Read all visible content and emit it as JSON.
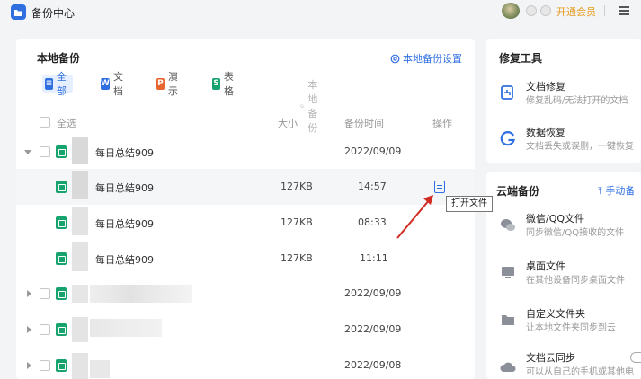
{
  "titlebar": {
    "title": "备份中心",
    "vip_label": "开通会员",
    "menu_icon": "menu-icon"
  },
  "local_backup": {
    "title": "本地备份",
    "settings_label": "本地备份设置",
    "filters": [
      {
        "label": "全部",
        "icon": "list-icon",
        "color": "#2f6fe0",
        "active": true
      },
      {
        "label": "文档",
        "icon": "W",
        "color": "#2f6fe0",
        "active": false
      },
      {
        "label": "演示",
        "icon": "P",
        "color": "#e8662e",
        "active": false
      },
      {
        "label": "表格",
        "icon": "S",
        "color": "#16a36e",
        "active": false
      }
    ],
    "search_placeholder": "本地备份",
    "columns": {
      "select_all": "全选",
      "size": "大小",
      "backup_time": "备份时间",
      "actions": "操作"
    },
    "rows": [
      {
        "name": "每日总结909",
        "size": "",
        "time": "2022/09/09",
        "type": "group",
        "expanded": true
      },
      {
        "name": "每日总结909",
        "size": "127KB",
        "time": "14:57",
        "type": "file",
        "highlighted": true
      },
      {
        "name": "每日总结909",
        "size": "127KB",
        "time": "08:33",
        "type": "file"
      },
      {
        "name": "每日总结909",
        "size": "127KB",
        "time": "11:11",
        "type": "file"
      },
      {
        "name": "",
        "size": "",
        "time": "2022/09/09",
        "type": "group",
        "expanded": false
      },
      {
        "name": "",
        "size": "",
        "time": "2022/09/09",
        "type": "group",
        "expanded": false
      },
      {
        "name": "",
        "size": "",
        "time": "2022/09/08",
        "type": "group",
        "expanded": false
      }
    ],
    "tooltip": "打开文件"
  },
  "repair_tools": {
    "title": "修复工具",
    "items": [
      {
        "title": "文档修复",
        "desc": "修复乱码/无法打开的文档",
        "icon": "doc-repair-icon"
      },
      {
        "title": "数据恢复",
        "desc": "文档丢失或误删，一键恢复",
        "icon": "data-recovery-icon"
      }
    ]
  },
  "cloud_backup": {
    "title": "云端备份",
    "manual_label": "手动备",
    "items": [
      {
        "title": "微信/QQ文件",
        "desc": "同步微信/QQ接收的文件",
        "icon": "wechat-qq-icon"
      },
      {
        "title": "桌面文件",
        "desc": "在其他设备同步桌面文件",
        "icon": "desktop-icon"
      },
      {
        "title": "自定义文件夹",
        "desc": "让本地文件夹同步到云",
        "icon": "folder-icon"
      },
      {
        "title": "文档云同步",
        "desc": "可以从自己的手机或其他电",
        "icon": "cloud-sync-icon"
      }
    ]
  }
}
